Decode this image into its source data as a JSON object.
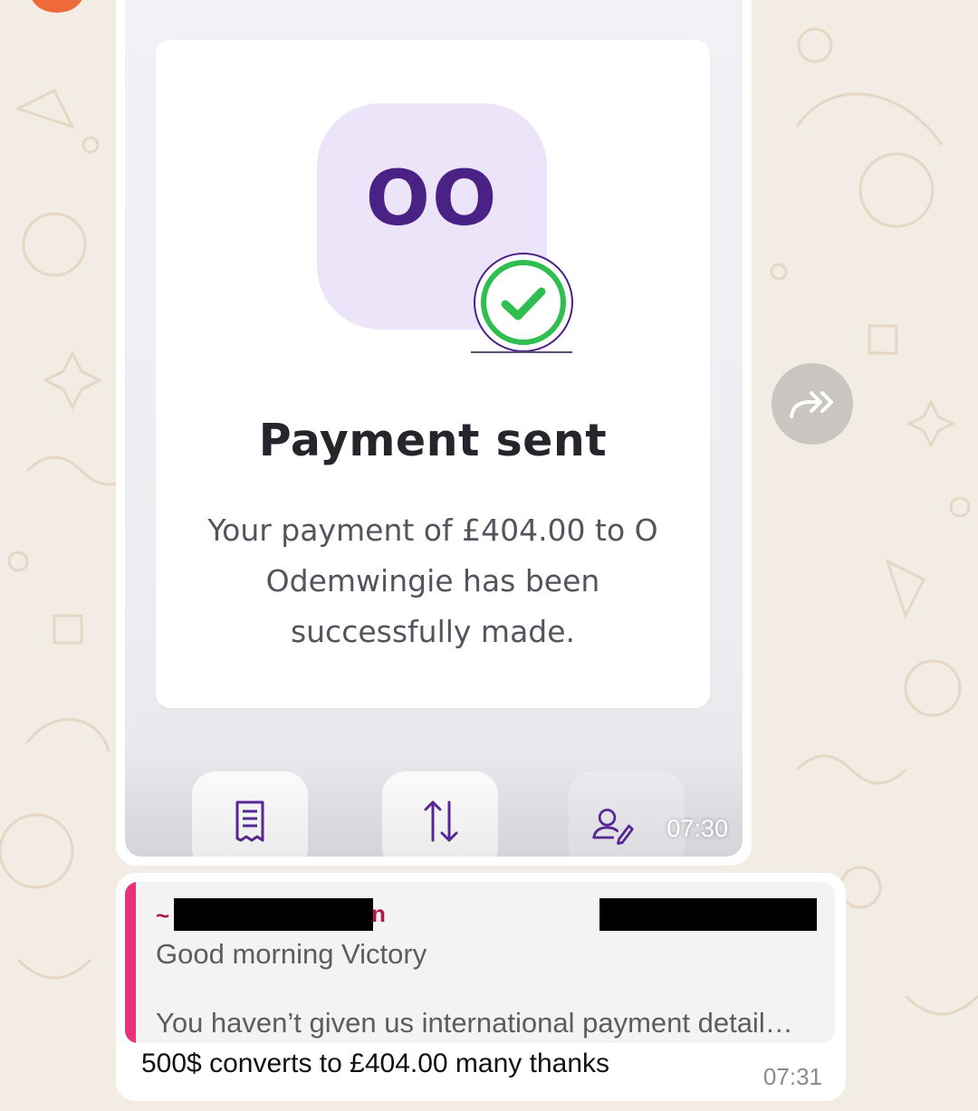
{
  "image_message": {
    "logo_text": "OO",
    "title": "Payment sent",
    "description": "Your payment of £404.00 to O Odemwingie has been successfully made.",
    "time": "07:30",
    "icons": [
      "receipt-icon",
      "transfer-arrows-icon",
      "edit-user-icon"
    ]
  },
  "forward": {
    "icon": "forward-icon"
  },
  "text_message": {
    "quote": {
      "sender_prefix": "~",
      "sender_tail": "n",
      "line1": "Good morning Victory",
      "line2": "You haven’t given us international payment detail…"
    },
    "text": "500$ converts to £404.00 many thanks",
    "time": "07:31"
  },
  "colors": {
    "accent_purple": "#4a2185",
    "check_green": "#2fbe4f",
    "quote_bar": "#e8317a",
    "quote_sender": "#b0174f"
  }
}
